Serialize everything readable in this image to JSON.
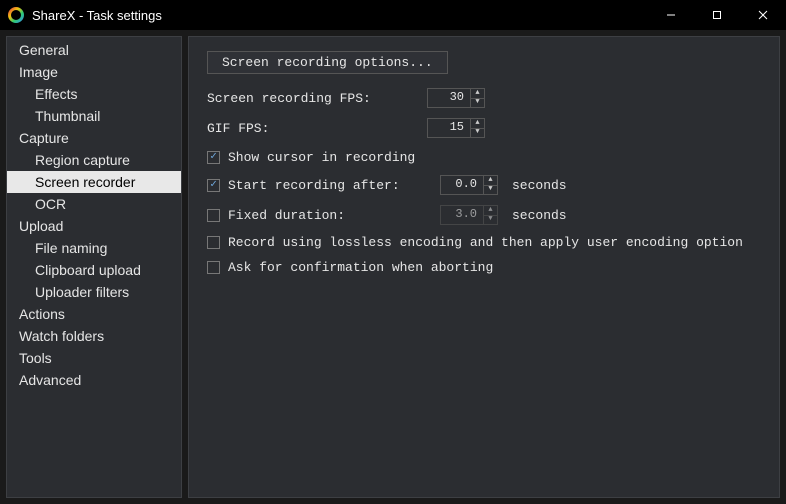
{
  "window": {
    "title": "ShareX - Task settings"
  },
  "sidebar": {
    "items": [
      {
        "label": "General",
        "indent": 0
      },
      {
        "label": "Image",
        "indent": 0
      },
      {
        "label": "Effects",
        "indent": 1
      },
      {
        "label": "Thumbnail",
        "indent": 1
      },
      {
        "label": "Capture",
        "indent": 0
      },
      {
        "label": "Region capture",
        "indent": 1
      },
      {
        "label": "Screen recorder",
        "indent": 1,
        "selected": true
      },
      {
        "label": "OCR",
        "indent": 1
      },
      {
        "label": "Upload",
        "indent": 0
      },
      {
        "label": "File naming",
        "indent": 1
      },
      {
        "label": "Clipboard upload",
        "indent": 1
      },
      {
        "label": "Uploader filters",
        "indent": 1
      },
      {
        "label": "Actions",
        "indent": 0
      },
      {
        "label": "Watch folders",
        "indent": 0
      },
      {
        "label": "Tools",
        "indent": 0
      },
      {
        "label": "Advanced",
        "indent": 0
      }
    ]
  },
  "content": {
    "options_button": "Screen recording options...",
    "fps_label": "Screen recording FPS:",
    "fps_value": "30",
    "gif_fps_label": "GIF FPS:",
    "gif_fps_value": "15",
    "show_cursor": {
      "checked": true,
      "label": "Show cursor in recording"
    },
    "start_after": {
      "checked": true,
      "label": "Start recording after:",
      "value": "0.0",
      "unit": "seconds"
    },
    "fixed_duration": {
      "checked": false,
      "label": "Fixed duration:",
      "value": "3.0",
      "unit": "seconds"
    },
    "lossless": {
      "checked": false,
      "label": "Record using lossless encoding and then apply user encoding option"
    },
    "ask_confirm": {
      "checked": false,
      "label": "Ask for confirmation when aborting"
    }
  }
}
